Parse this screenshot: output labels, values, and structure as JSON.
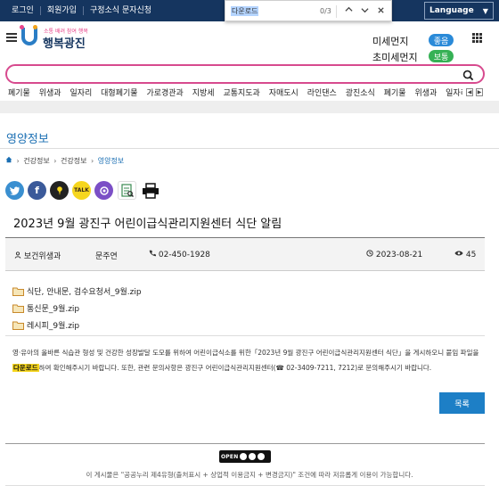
{
  "topbar": {
    "links": [
      "로그인",
      "회원가입",
      "구정소식 문자신청"
    ],
    "language_label": "Language",
    "colors": {
      "topbar_bg": "#15355f",
      "accent": "#1b6fb3",
      "search_border": "#d74a8e"
    }
  },
  "findbar": {
    "query": "다운로드",
    "count": "0/3",
    "icons": [
      "chevron-up-icon",
      "chevron-down-icon",
      "close-icon"
    ]
  },
  "header": {
    "logo_small": "소통 배려 참여 행복",
    "logo_main": "행복광진",
    "air": [
      {
        "label": "미세먼지",
        "status": "좋음",
        "color": "#2a8ad8"
      },
      {
        "label": "초미세먼지",
        "status": "보통",
        "color": "#36b155"
      }
    ]
  },
  "search": {
    "value": "",
    "placeholder": ""
  },
  "keywords": [
    "폐기물",
    "위생과",
    "일자리",
    "대형폐기물",
    "가로경관과",
    "지방세",
    "교통지도과",
    "자매도시",
    "라인댄스",
    "광진소식",
    "폐기물",
    "위생과",
    "일자리"
  ],
  "section": {
    "title": "영양정보",
    "breadcrumb": [
      "건강정보",
      "건강정보",
      "영양정보"
    ]
  },
  "share_icons": [
    "twitter-icon",
    "facebook-icon",
    "kakaostory-icon",
    "kakaotalk-icon",
    "band-icon",
    "print-preview-icon",
    "print-icon"
  ],
  "post": {
    "title": "2023년 9월 광진구 어린이급식관리지원센터 식단 알림",
    "department": "보건위생과",
    "author": "문주연",
    "phone": "02-450-1928",
    "date": "2023-08-21",
    "views": "45",
    "files": [
      "식단, 안내문, 검수요청서_9월.zip",
      "통신문_9월.zip",
      "레시피_9월.zip"
    ],
    "body_part1": "영·유아의 올바른 식습관 형성 및 건강한 성장발달 도모를 위하여 어린이급식소를 위한「2023년 9월 광진구 어린이급식관리지원센터 식단」을 게시하오니 붙임 파일을 ",
    "body_highlight": "다운로드",
    "body_part2": "하여 확인해주시기 바랍니다. 또한, 관련 문의사항은 광진구 어린이급식관리지원센터(☎ 02-3409-7211, 7212)로 문의해주시기 바랍니다."
  },
  "list_button": "목록",
  "footer": {
    "license_label": "OPEN",
    "note": "이 게시물은 \"공공누리 제4유형(출처표시 + 상업적 이용금지 + 변경금지)\" 조건에 따라 저유롭게 이용이 가능합니다."
  }
}
